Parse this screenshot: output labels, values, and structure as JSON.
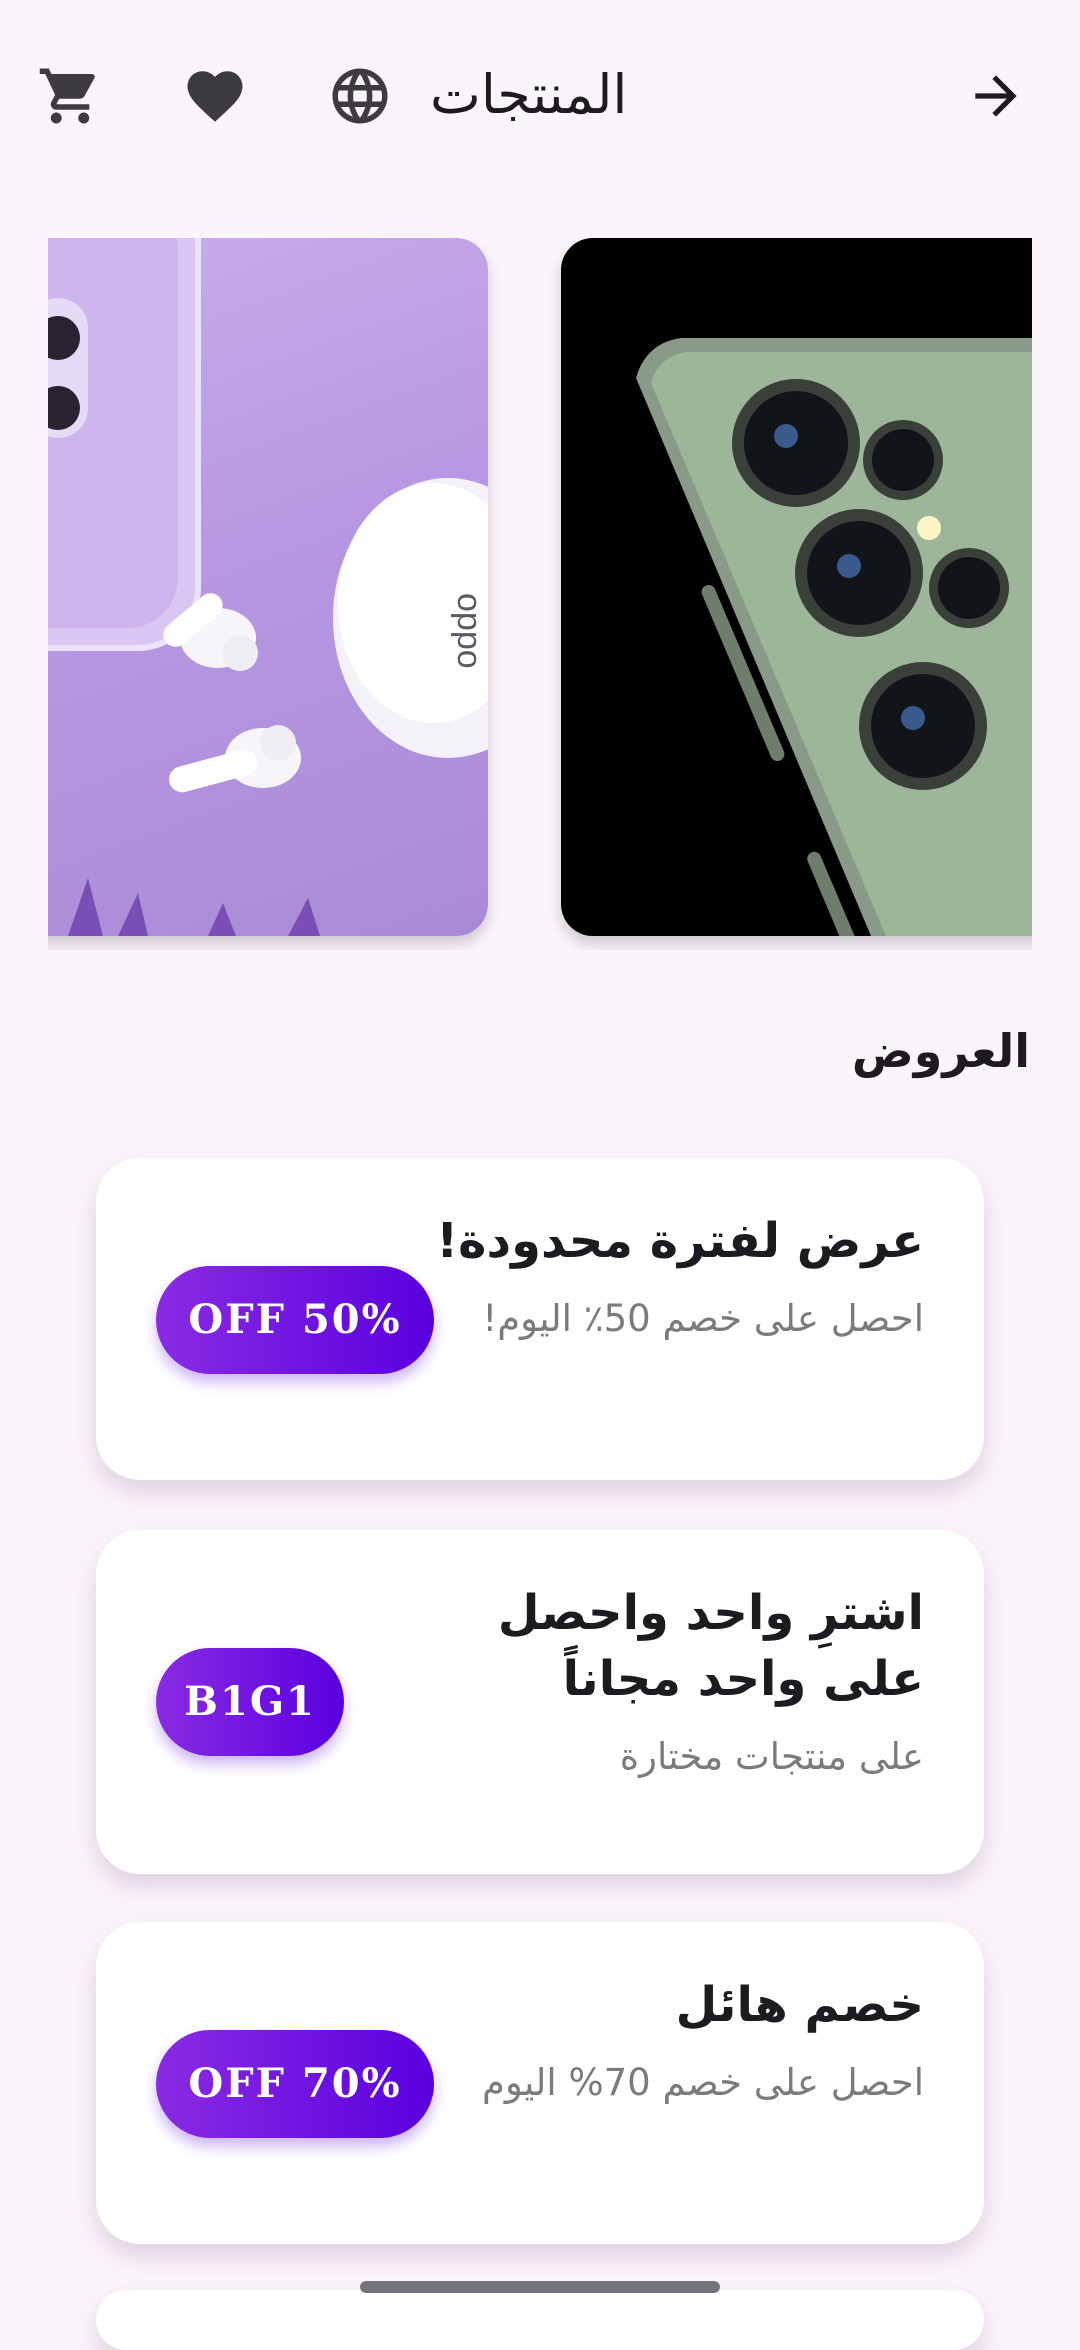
{
  "app_bar": {
    "title": "المنتجات",
    "icons": [
      "cart-icon",
      "heart-icon",
      "globe-icon",
      "arrow-forward-icon"
    ]
  },
  "carousel": {
    "slides": [
      {
        "subject": "purple-phone-and-earbuds",
        "logo_text": "oppo"
      },
      {
        "subject": "green-phone-camera"
      }
    ]
  },
  "offers_section": {
    "title": "العروض"
  },
  "offers": [
    {
      "title": "عرض لفترة محدودة!",
      "description": "احصل على خصم 50٪ اليوم!",
      "badge": "OFF 50%"
    },
    {
      "title": "اشترِ واحد واحصل على واحد مجاناً",
      "description": "على منتجات مختارة",
      "badge": "B1G1"
    },
    {
      "title": "خصم هائل",
      "description": "احصل على خصم 70% اليوم",
      "badge": "OFF 70%"
    }
  ],
  "colors": {
    "background": "#fcf4fb",
    "badge_start": "#8a2be2",
    "badge_end": "#5a00e0",
    "card": "#ffffff"
  }
}
